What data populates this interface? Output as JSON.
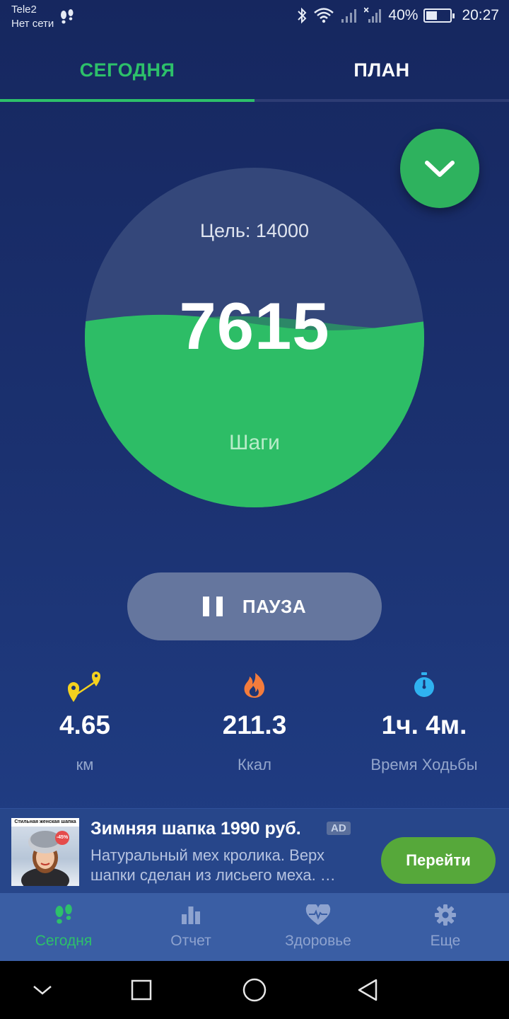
{
  "status_bar": {
    "carrier": "Tele2",
    "network": "Нет сети",
    "battery": "40%",
    "time": "20:27"
  },
  "tabs": [
    {
      "label": "СЕГОДНЯ",
      "active": true
    },
    {
      "label": "ПЛАН",
      "active": false
    }
  ],
  "progress": {
    "goal_label": "Цель: 14000",
    "steps": "7615",
    "steps_label": "Шаги",
    "fill_fraction": 0.544
  },
  "pause_button": {
    "label": "ПАУЗА"
  },
  "stats": [
    {
      "value": "4.65",
      "unit": "км",
      "icon": "distance-pin-icon"
    },
    {
      "value": "211.3",
      "unit": "Ккал",
      "icon": "flame-icon"
    },
    {
      "value": "1ч. 4м.",
      "unit": "Время Ходьбы",
      "icon": "stopwatch-icon"
    }
  ],
  "ad": {
    "title": "Зимняя шапка 1990 руб.",
    "badge": "AD",
    "description": "Натуральный мех кролика. Верх шапки сделан из лисьего меха. …",
    "cta": "Перейти",
    "image_caption": "Стильная женская шапка",
    "image_discount": "-45%"
  },
  "bottom_nav": [
    {
      "label": "Сегодня",
      "icon": "footsteps-icon",
      "active": true
    },
    {
      "label": "Отчет",
      "icon": "bar-chart-icon",
      "active": false
    },
    {
      "label": "Здоровье",
      "icon": "heart-pulse-icon",
      "active": false
    },
    {
      "label": "Еще",
      "icon": "gear-icon",
      "active": false
    }
  ],
  "colors": {
    "accent_green": "#2dc06a",
    "background": "#1b3170",
    "cta_green": "#56a83a"
  }
}
